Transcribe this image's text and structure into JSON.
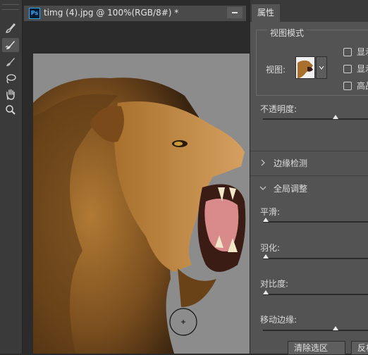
{
  "toolbar": {
    "tools": [
      {
        "icon": "quick-selection-brush-icon",
        "active": false
      },
      {
        "icon": "refine-edge-brush-icon",
        "active": true
      },
      {
        "icon": "brush-icon",
        "active": false
      },
      {
        "icon": "lasso-icon",
        "active": false
      },
      {
        "icon": "hand-icon",
        "active": false
      },
      {
        "icon": "zoom-icon",
        "active": false
      }
    ]
  },
  "document": {
    "app_badge": "Ps",
    "title": "timg (4).jpg @ 100%(RGB/8#) *"
  },
  "properties": {
    "tab_label": "属性",
    "view_mode": {
      "group_title": "视图模式",
      "view_label": "视图:",
      "options": [
        "显示",
        "显示",
        "高品"
      ]
    },
    "opacity": {
      "label": "不透明度:",
      "value": 0.65
    },
    "edge_detection": {
      "label": "边缘检测"
    },
    "global_refine": {
      "label": "全局调整",
      "smooth": {
        "label": "平滑:",
        "value": 0
      },
      "feather": {
        "label": "羽化:",
        "value": 0
      },
      "contrast": {
        "label": "对比度:",
        "value": 0
      },
      "shift_edge": {
        "label": "移动边缘:",
        "value": 0.65
      }
    },
    "buttons": {
      "clear_selection": "清除选区",
      "invert": "反相"
    }
  },
  "colors": {
    "accent": "#31a8ff",
    "panel": "#535353",
    "canvas_bg": "#8a8a8a"
  }
}
